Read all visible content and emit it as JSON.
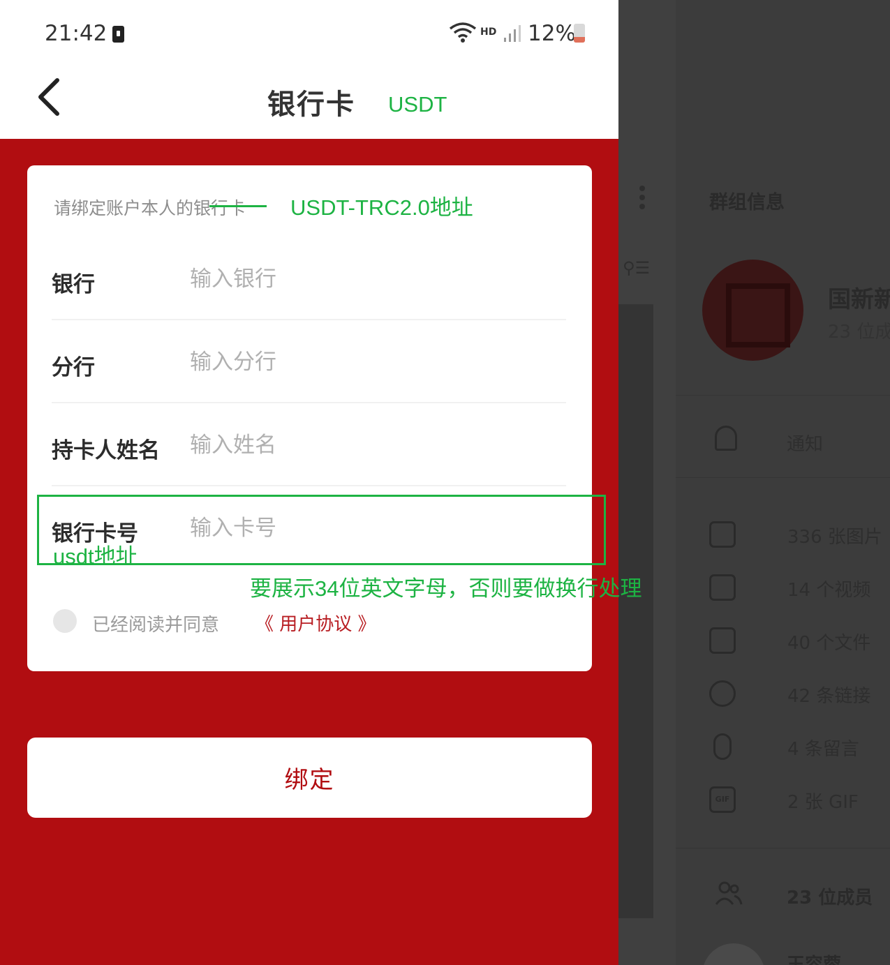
{
  "status_bar": {
    "time": "21:42",
    "network_label": "HD",
    "battery": "12%"
  },
  "nav": {
    "title": "银行卡",
    "back_icon": "chevron-left-icon"
  },
  "form": {
    "hint": "请绑定账户本人的银行卡",
    "fields": [
      {
        "label": "银行",
        "placeholder": "输入银行",
        "value": ""
      },
      {
        "label": "分行",
        "placeholder": "输入分行",
        "value": ""
      },
      {
        "label": "持卡人姓名",
        "placeholder": "输入姓名",
        "value": ""
      },
      {
        "label": "银行卡号",
        "placeholder": "输入卡号",
        "value": ""
      }
    ],
    "agreement": {
      "text": "已经阅读并同意",
      "link": "《 用户协议 》",
      "checked": false
    }
  },
  "bind_button": "绑定",
  "annotations": {
    "title_replace": "USDT",
    "hint_replace": "USDT-TRC2.0地址",
    "card_field_replace": "usdt地址",
    "note": "要展示34位英文字母，否则要做换行处理"
  },
  "background_panel": {
    "title": "群组信息",
    "group_name": "国新新",
    "member_count": "23 位成",
    "notification": "通知",
    "media": [
      {
        "icon": "image-icon",
        "text": "336 张图片"
      },
      {
        "icon": "video-icon",
        "text": "14 个视频"
      },
      {
        "icon": "file-icon",
        "text": "40 个文件"
      },
      {
        "icon": "link-icon",
        "text": "42 条链接"
      },
      {
        "icon": "mic-icon",
        "text": "4 条留言"
      },
      {
        "icon": "gif-icon",
        "text": "2 张 GIF"
      }
    ],
    "members": "23 位成员",
    "member_name": "王容蓉"
  },
  "colors": {
    "brand_red": "#b10d11",
    "annotation_green": "#1db343"
  }
}
